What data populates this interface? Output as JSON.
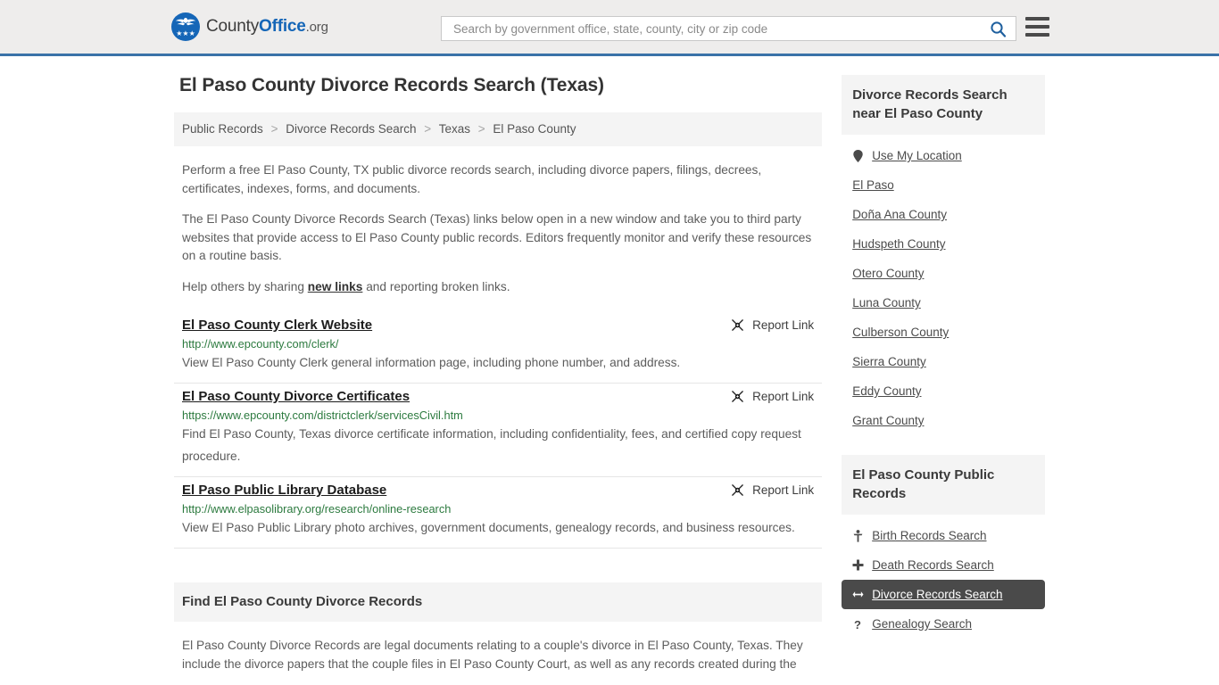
{
  "header": {
    "logo": {
      "text_part1": "County",
      "text_part2": "Office",
      "text_part3": ".org",
      "icon": "eagle-shield-logo",
      "brand_blue": "#1566b7"
    },
    "search": {
      "placeholder": "Search by government office, state, county, city or zip code",
      "value": "",
      "icon": "search-icon"
    },
    "menu_icon": "hamburger-menu-icon",
    "border_color": "#3a72a8"
  },
  "main": {
    "page_title": "El Paso County Divorce Records Search (Texas)",
    "breadcrumb": [
      "Public Records",
      "Divorce Records Search",
      "Texas",
      "El Paso County"
    ],
    "breadcrumb_separator": ">",
    "intro_paragraphs": [
      "Perform a free El Paso County, TX public divorce records search, including divorce papers, filings, decrees, certificates, indexes, forms, and documents.",
      "The El Paso County Divorce Records Search (Texas) links below open in a new window and take you to third party websites that provide access to El Paso County public records. Editors frequently monitor and verify these resources on a routine basis."
    ],
    "help_line": {
      "before": "Help others by sharing ",
      "link": "new links",
      "after": " and reporting broken links."
    },
    "report_link_label": "Report Link",
    "report_link_icon": "broken-link-icon",
    "results": [
      {
        "title": "El Paso County Clerk Website",
        "url": "http://www.epcounty.com/clerk/",
        "description": "View El Paso County Clerk general information page, including phone number, and address."
      },
      {
        "title": "El Paso County Divorce Certificates",
        "url": "https://www.epcounty.com/districtclerk/servicesCivil.htm",
        "description": "Find El Paso County, Texas divorce certificate information, including confidentiality, fees, and certified copy request procedure."
      },
      {
        "title": "El Paso Public Library Database",
        "url": "http://www.elpasolibrary.org/research/online-research",
        "description": "View El Paso Public Library photo archives, government documents, genealogy records, and business resources."
      }
    ],
    "section": {
      "heading": "Find El Paso County Divorce Records",
      "body": "El Paso County Divorce Records are legal documents relating to a couple's divorce in El Paso County, Texas. They include the divorce papers that the couple files in El Paso County Court, as well as any records created during the"
    }
  },
  "sidebar": {
    "nearby_panel": {
      "heading": "Divorce Records Search near El Paso County",
      "items": [
        {
          "label": "Use My Location",
          "icon": "map-pin-icon"
        },
        {
          "label": "El Paso",
          "icon": ""
        },
        {
          "label": "Doña Ana County",
          "icon": ""
        },
        {
          "label": "Hudspeth County",
          "icon": ""
        },
        {
          "label": "Otero County",
          "icon": ""
        },
        {
          "label": "Luna County",
          "icon": ""
        },
        {
          "label": "Culberson County",
          "icon": ""
        },
        {
          "label": "Sierra County",
          "icon": ""
        },
        {
          "label": "Eddy County",
          "icon": ""
        },
        {
          "label": "Grant County",
          "icon": ""
        }
      ]
    },
    "records_panel": {
      "heading": "El Paso County Public Records",
      "items": [
        {
          "label": "Birth Records Search",
          "icon": "person-icon",
          "active": false
        },
        {
          "label": "Death Records Search",
          "icon": "cross-icon",
          "active": false
        },
        {
          "label": "Divorce Records Search",
          "icon": "double-arrow-icon",
          "active": true
        },
        {
          "label": "Genealogy Search",
          "icon": "question-mark-icon",
          "active": false
        }
      ],
      "active_bg": "#4a4a4a"
    }
  }
}
